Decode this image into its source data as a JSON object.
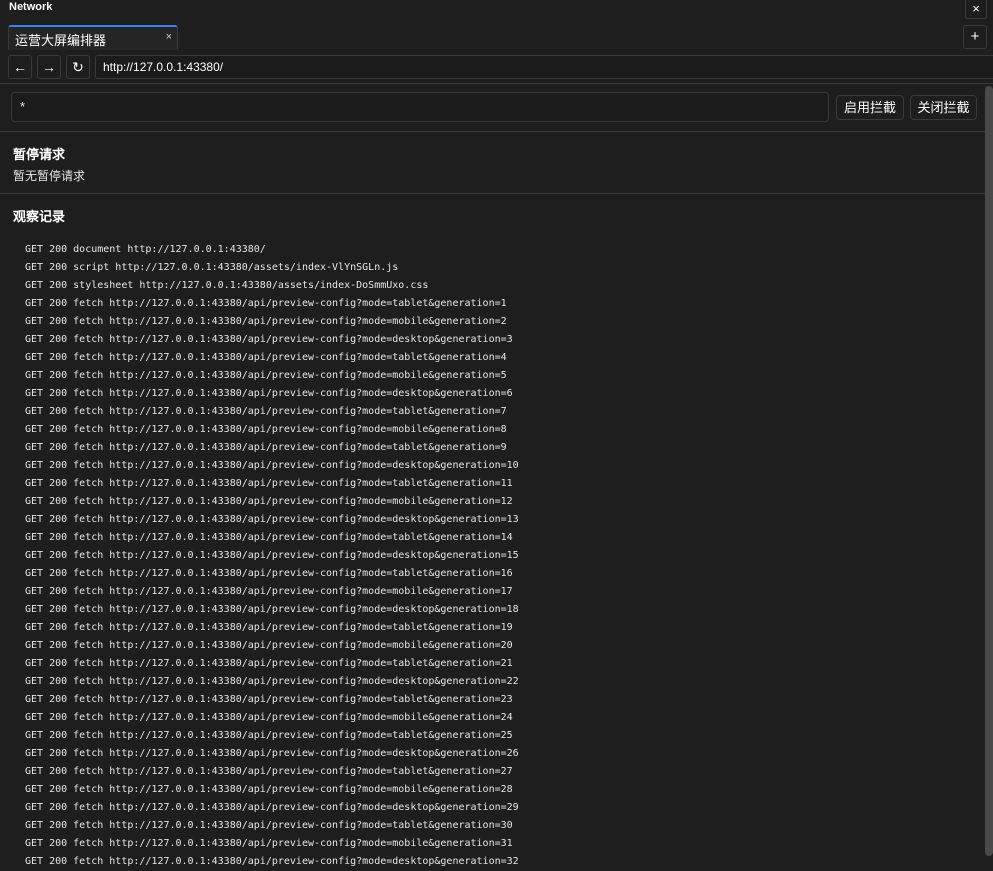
{
  "window": {
    "title": "Network",
    "close": "×"
  },
  "tabs": [
    {
      "label": "运营大屏编排器",
      "close": "×"
    }
  ],
  "new_tab": "+",
  "nav": {
    "back": "←",
    "forward": "→",
    "reload": "↻",
    "url": "http://127.0.0.1:43380/"
  },
  "filter": {
    "value": "*",
    "enable_label": "启用拦截",
    "disable_label": "关闭拦截"
  },
  "paused": {
    "title": "暂停请求",
    "empty": "暂无暂停请求"
  },
  "log": {
    "title": "观察记录",
    "entries": [
      "GET 200 document http://127.0.0.1:43380/",
      "GET 200 script http://127.0.0.1:43380/assets/index-VlYnSGLn.js",
      "GET 200 stylesheet http://127.0.0.1:43380/assets/index-DoSmmUxo.css",
      "GET 200 fetch http://127.0.0.1:43380/api/preview-config?mode=tablet&generation=1",
      "GET 200 fetch http://127.0.0.1:43380/api/preview-config?mode=mobile&generation=2",
      "GET 200 fetch http://127.0.0.1:43380/api/preview-config?mode=desktop&generation=3",
      "GET 200 fetch http://127.0.0.1:43380/api/preview-config?mode=tablet&generation=4",
      "GET 200 fetch http://127.0.0.1:43380/api/preview-config?mode=mobile&generation=5",
      "GET 200 fetch http://127.0.0.1:43380/api/preview-config?mode=desktop&generation=6",
      "GET 200 fetch http://127.0.0.1:43380/api/preview-config?mode=tablet&generation=7",
      "GET 200 fetch http://127.0.0.1:43380/api/preview-config?mode=mobile&generation=8",
      "GET 200 fetch http://127.0.0.1:43380/api/preview-config?mode=tablet&generation=9",
      "GET 200 fetch http://127.0.0.1:43380/api/preview-config?mode=desktop&generation=10",
      "GET 200 fetch http://127.0.0.1:43380/api/preview-config?mode=tablet&generation=11",
      "GET 200 fetch http://127.0.0.1:43380/api/preview-config?mode=mobile&generation=12",
      "GET 200 fetch http://127.0.0.1:43380/api/preview-config?mode=desktop&generation=13",
      "GET 200 fetch http://127.0.0.1:43380/api/preview-config?mode=tablet&generation=14",
      "GET 200 fetch http://127.0.0.1:43380/api/preview-config?mode=desktop&generation=15",
      "GET 200 fetch http://127.0.0.1:43380/api/preview-config?mode=tablet&generation=16",
      "GET 200 fetch http://127.0.0.1:43380/api/preview-config?mode=mobile&generation=17",
      "GET 200 fetch http://127.0.0.1:43380/api/preview-config?mode=desktop&generation=18",
      "GET 200 fetch http://127.0.0.1:43380/api/preview-config?mode=tablet&generation=19",
      "GET 200 fetch http://127.0.0.1:43380/api/preview-config?mode=mobile&generation=20",
      "GET 200 fetch http://127.0.0.1:43380/api/preview-config?mode=tablet&generation=21",
      "GET 200 fetch http://127.0.0.1:43380/api/preview-config?mode=desktop&generation=22",
      "GET 200 fetch http://127.0.0.1:43380/api/preview-config?mode=tablet&generation=23",
      "GET 200 fetch http://127.0.0.1:43380/api/preview-config?mode=mobile&generation=24",
      "GET 200 fetch http://127.0.0.1:43380/api/preview-config?mode=tablet&generation=25",
      "GET 200 fetch http://127.0.0.1:43380/api/preview-config?mode=desktop&generation=26",
      "GET 200 fetch http://127.0.0.1:43380/api/preview-config?mode=tablet&generation=27",
      "GET 200 fetch http://127.0.0.1:43380/api/preview-config?mode=mobile&generation=28",
      "GET 200 fetch http://127.0.0.1:43380/api/preview-config?mode=desktop&generation=29",
      "GET 200 fetch http://127.0.0.1:43380/api/preview-config?mode=tablet&generation=30",
      "GET 200 fetch http://127.0.0.1:43380/api/preview-config?mode=mobile&generation=31",
      "GET 200 fetch http://127.0.0.1:43380/api/preview-config?mode=desktop&generation=32"
    ]
  }
}
